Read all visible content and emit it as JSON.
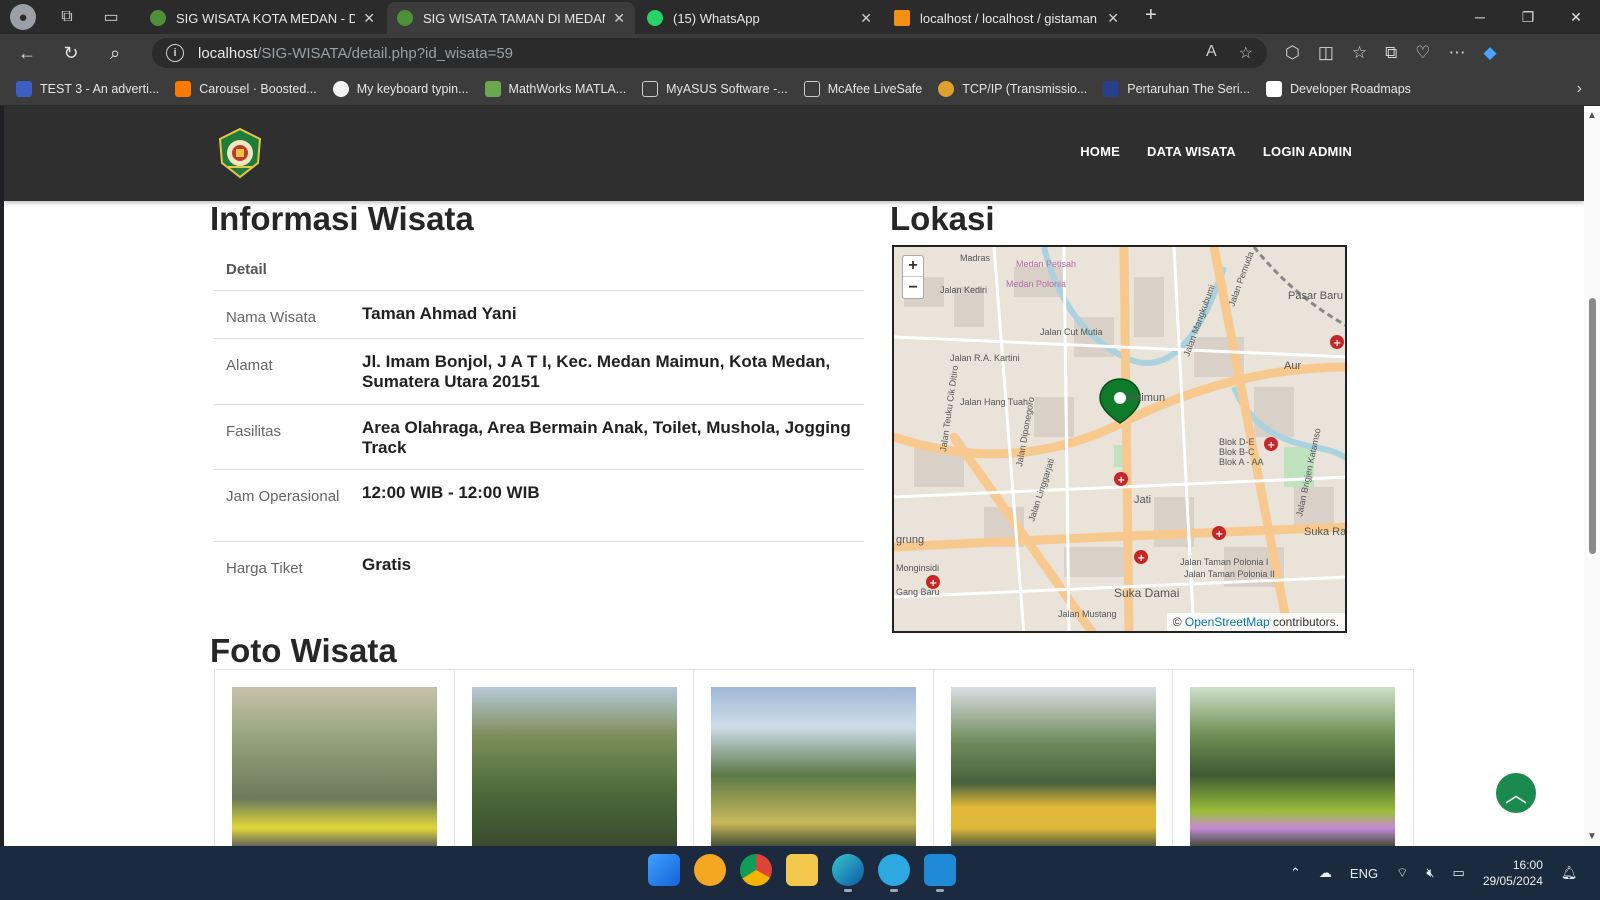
{
  "browser": {
    "tabs": [
      {
        "title": "SIG WISATA KOTA MEDAN - Dasl",
        "active": false,
        "favicon_color": "#4f8f3a"
      },
      {
        "title": "SIG WISATA TAMAN DI MEDAN",
        "active": true,
        "favicon_color": "#4f8f3a"
      },
      {
        "title": "(15) WhatsApp",
        "active": false,
        "favicon_color": "#25d366"
      },
      {
        "title": "localhost / localhost / gistaman |",
        "active": false,
        "favicon_color": "#f29111"
      }
    ],
    "url_host": "localhost",
    "url_path": "/SIG-WISATA/detail.php?id_wisata=59",
    "bookmarks": [
      {
        "label": "TEST 3 - An adverti...",
        "color": "#3b5fc0"
      },
      {
        "label": "Carousel · Boosted...",
        "color": "#ff7900"
      },
      {
        "label": "My keyboard typin...",
        "color": "#f5f5f5"
      },
      {
        "label": "MathWorks MATLA...",
        "color": "#6aa84f"
      },
      {
        "label": "MyASUS Software -...",
        "color": "#cccccc"
      },
      {
        "label": "McAfee LiveSafe",
        "color": "#cccccc"
      },
      {
        "label": "TCP/IP (Transmissio...",
        "color": "#e0a030"
      },
      {
        "label": "Pertaruhan The Seri...",
        "color": "#2a3f8a"
      },
      {
        "label": "Developer Roadmaps",
        "color": "#ffffff"
      }
    ]
  },
  "site": {
    "nav": [
      "HOME",
      "DATA WISATA",
      "LOGIN ADMIN"
    ],
    "info_title": "Informasi Wisata",
    "table_header": "Detail",
    "rows": [
      {
        "label": "Nama Wisata",
        "value": "Taman Ahmad Yani"
      },
      {
        "label": "Alamat",
        "value": "Jl. Imam Bonjol, J A T I, Kec. Medan Maimun, Kota Medan, Sumatera Utara 20151"
      },
      {
        "label": "Fasilitas",
        "value": "Area Olahraga, Area Bermain Anak, Toilet, Mushola, Jogging Track"
      },
      {
        "label": "Jam Operasional",
        "value": "12:00 WIB - 12:00 WIB"
      },
      {
        "label": "Harga Tiket",
        "value": "Gratis"
      }
    ],
    "location_title": "Lokasi",
    "map": {
      "zoom_in": "+",
      "zoom_out": "−",
      "attribution_prefix": "©",
      "attribution_link": "OpenStreetMap",
      "attribution_suffix": "contributors.",
      "labels": [
        "Madras",
        "Jalan Kediri",
        "Jalan Cut Mutia",
        "Jalan R.A. Kartini",
        "Jalan Hang Tuah",
        "Jalan Diponegoro",
        "Jalan Teuku Cik Ditiro",
        "Jalan Mangkubumi",
        "Jalan Pemuda",
        "Pasar Baru",
        "Aur",
        "Maimun",
        "Jati",
        "Blok D-E",
        "Blok B-C",
        "Blok A - AA",
        "Jalan Brigjen Katamso",
        "Suka Ra",
        "grung",
        "Monginsidi",
        "Gang Baru",
        "Jalan Taman Polonia I",
        "Jalan Taman Polonia II",
        "Suka Damai",
        "Jalan Mustang",
        "Jalan Linggarjati",
        "Medan Petisah",
        "Medan Polonia"
      ]
    },
    "photos_title": "Foto Wisata",
    "photos": [
      {
        "alt": "Gerbang Taman Ahmad Yani",
        "palette": [
          "#6b7a5a",
          "#c8c2a8",
          "#e1d83a"
        ]
      },
      {
        "alt": "Pepohonan taman",
        "palette": [
          "#4d6b3a",
          "#b9c9d9",
          "#7d8f5c"
        ]
      },
      {
        "alt": "Monumen di taman",
        "palette": [
          "#5c7a48",
          "#9fb8d6",
          "#c9b75a"
        ]
      },
      {
        "alt": "Tulisan TAMAN",
        "palette": [
          "#47603c",
          "#d9dfe2",
          "#e1b93a"
        ]
      },
      {
        "alt": "Papan nama taman berwarna",
        "palette": [
          "#3f5a33",
          "#cfe0c9",
          "#9bbf3a"
        ]
      }
    ]
  },
  "taskbar": {
    "lang": "ENG",
    "time": "16:00",
    "date": "29/05/2024"
  }
}
